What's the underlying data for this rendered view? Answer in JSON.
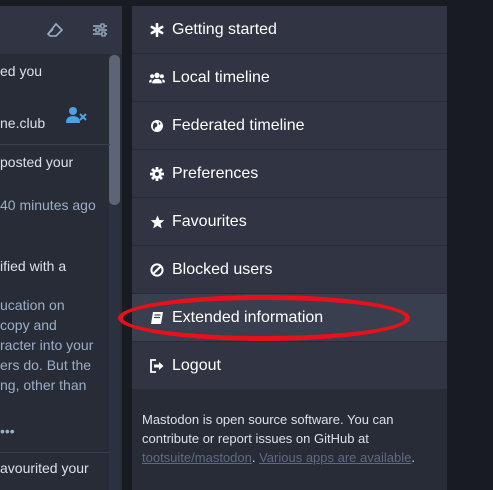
{
  "left_column": {
    "fragments": [
      {
        "text": "ed you",
        "muted": false
      },
      {
        "text": "ne.club",
        "muted": false
      },
      {
        "text": "posted your",
        "muted": false
      },
      {
        "text": "40 minutes ago",
        "muted": true
      },
      {
        "text": "ified with a",
        "muted": false
      },
      {
        "text": "ucation on",
        "muted": true
      },
      {
        "text": "copy and",
        "muted": true
      },
      {
        "text": "racter into your",
        "muted": true
      },
      {
        "text": "ers do. But the",
        "muted": true
      },
      {
        "text": "ng, other than",
        "muted": true
      },
      {
        "text": "avourited your",
        "muted": false
      }
    ],
    "more_dots": "•••",
    "header_icons": [
      "eraser-icon",
      "sliders-icon"
    ],
    "follower_icon": "user-remove-icon"
  },
  "nav": {
    "items": [
      {
        "label": "Getting started",
        "icon": "asterisk-icon",
        "active": false
      },
      {
        "label": "Local timeline",
        "icon": "users-icon",
        "active": false
      },
      {
        "label": "Federated timeline",
        "icon": "globe-icon",
        "active": false
      },
      {
        "label": "Preferences",
        "icon": "cog-icon",
        "active": false
      },
      {
        "label": "Favourites",
        "icon": "star-icon",
        "active": false
      },
      {
        "label": "Blocked users",
        "icon": "ban-icon",
        "active": false
      },
      {
        "label": "Extended information",
        "icon": "book-icon",
        "active": true
      },
      {
        "label": "Logout",
        "icon": "sign-out-icon",
        "active": false
      }
    ]
  },
  "footer": {
    "text_1": "Mastodon is open source software. You can contribute or report issues on GitHub at",
    "repo_link": "tootsuite/mastodon",
    "separator": ". ",
    "apps_link": "Various apps are available",
    "end": "."
  },
  "colors": {
    "background": "#191b22",
    "panel": "#282c37",
    "item": "#313543",
    "item_active": "#393f4f",
    "highlight": "#e8101a"
  }
}
